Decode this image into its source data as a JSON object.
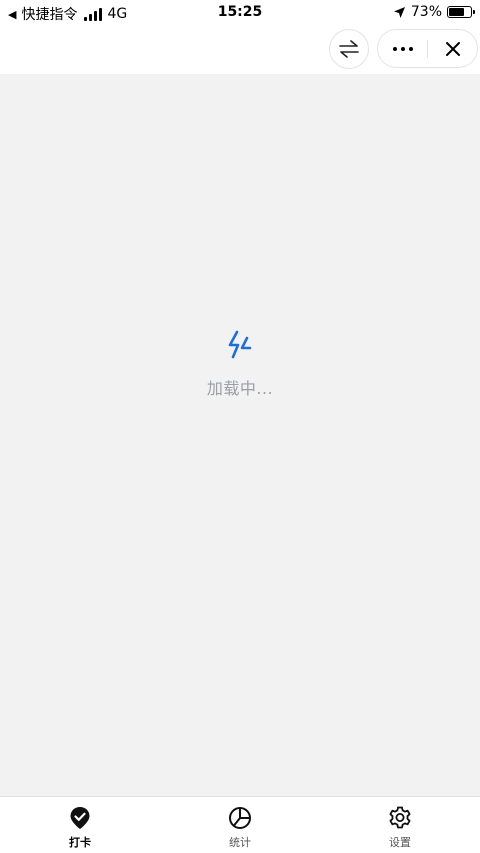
{
  "status_bar": {
    "back_app": "快捷指令",
    "network": "4G",
    "time": "15:25",
    "battery_percent": "73%",
    "battery_level": 0.73
  },
  "nav_bar": {
    "icons": [
      "switch-arrows-icon",
      "more-dots-icon",
      "close-icon"
    ]
  },
  "loading": {
    "text": "加载中...",
    "icon": "lightning-bolt-icon",
    "color": "#1f6fd6"
  },
  "tab_bar": {
    "items": [
      {
        "label": "打卡",
        "icon": "check-pin-icon",
        "active": true
      },
      {
        "label": "统计",
        "icon": "pie-chart-icon",
        "active": false
      },
      {
        "label": "设置",
        "icon": "gear-icon",
        "active": false
      }
    ]
  }
}
